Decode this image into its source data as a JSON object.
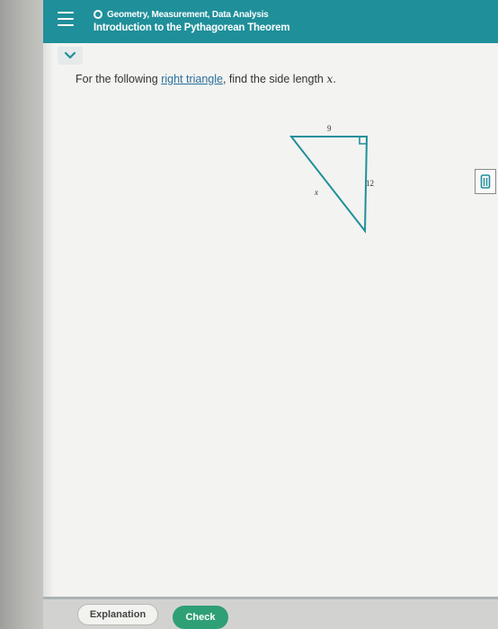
{
  "header": {
    "topic": "Geometry, Measurement, Data Analysis",
    "lesson_title": "Introduction to the Pythagorean Theorem",
    "bg_color": "#1f8f9a"
  },
  "question": {
    "prefix": "For the following ",
    "link_text": "right triangle",
    "suffix": ", find the side length ",
    "variable": "x",
    "end": "."
  },
  "figure": {
    "top_side": "9",
    "right_side": "12",
    "hypotenuse": "x"
  },
  "footer": {
    "explanation_label": "Explanation",
    "check_label": "Check",
    "check_color": "#2f9f76"
  },
  "icons": {
    "menu": "hamburger-icon",
    "expand": "chevron-down-icon",
    "side": "calculator-icon"
  }
}
